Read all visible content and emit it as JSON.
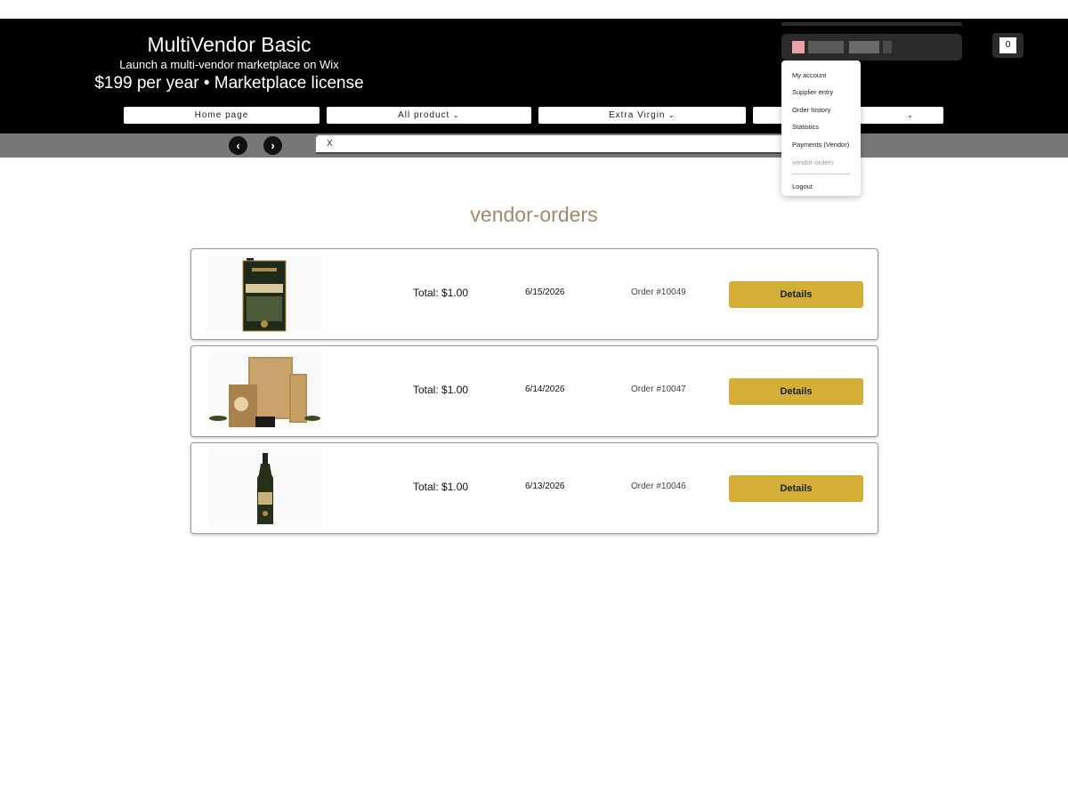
{
  "brand": {
    "title": "MultiVendor Basic",
    "subtitle": "Launch a multi-vendor marketplace on Wix",
    "price": "$199 per year • Marketplace license"
  },
  "cart": {
    "count": "0"
  },
  "nav": {
    "items": [
      {
        "label": "Home page",
        "dropdown": false
      },
      {
        "label": "All product",
        "dropdown": true
      },
      {
        "label": "Extra Virgin",
        "dropdown": true
      },
      {
        "label": "",
        "dropdown": true
      }
    ]
  },
  "search": {
    "value": "X"
  },
  "account_menu": {
    "items": [
      "My account",
      "Supplier entry",
      "Order history",
      "Statistics",
      "Payments (Vendor)",
      "vendor-orders"
    ],
    "active": "vendor-orders",
    "logout": "Logout"
  },
  "page": {
    "title": "vendor-orders"
  },
  "orders": [
    {
      "total": "Total: $1.00",
      "date": "6/15/2026",
      "order_no": "Order #10049",
      "button": "Details",
      "product": "tin"
    },
    {
      "total": "Total: $1.00",
      "date": "6/14/2026",
      "order_no": "Order #10047",
      "button": "Details",
      "product": "giftbox"
    },
    {
      "total": "Total: $1.00",
      "date": "6/13/2026",
      "order_no": "Order #10046",
      "button": "Details",
      "product": "bottle"
    }
  ],
  "colors": {
    "header_bg": "#000000",
    "subbar_bg": "#777777",
    "accent_gold": "#d4af37",
    "title_color": "#a08a6b"
  },
  "icons": {
    "prev": "chevron-left-icon",
    "next": "chevron-right-icon",
    "dropdown": "chevron-down-icon"
  }
}
